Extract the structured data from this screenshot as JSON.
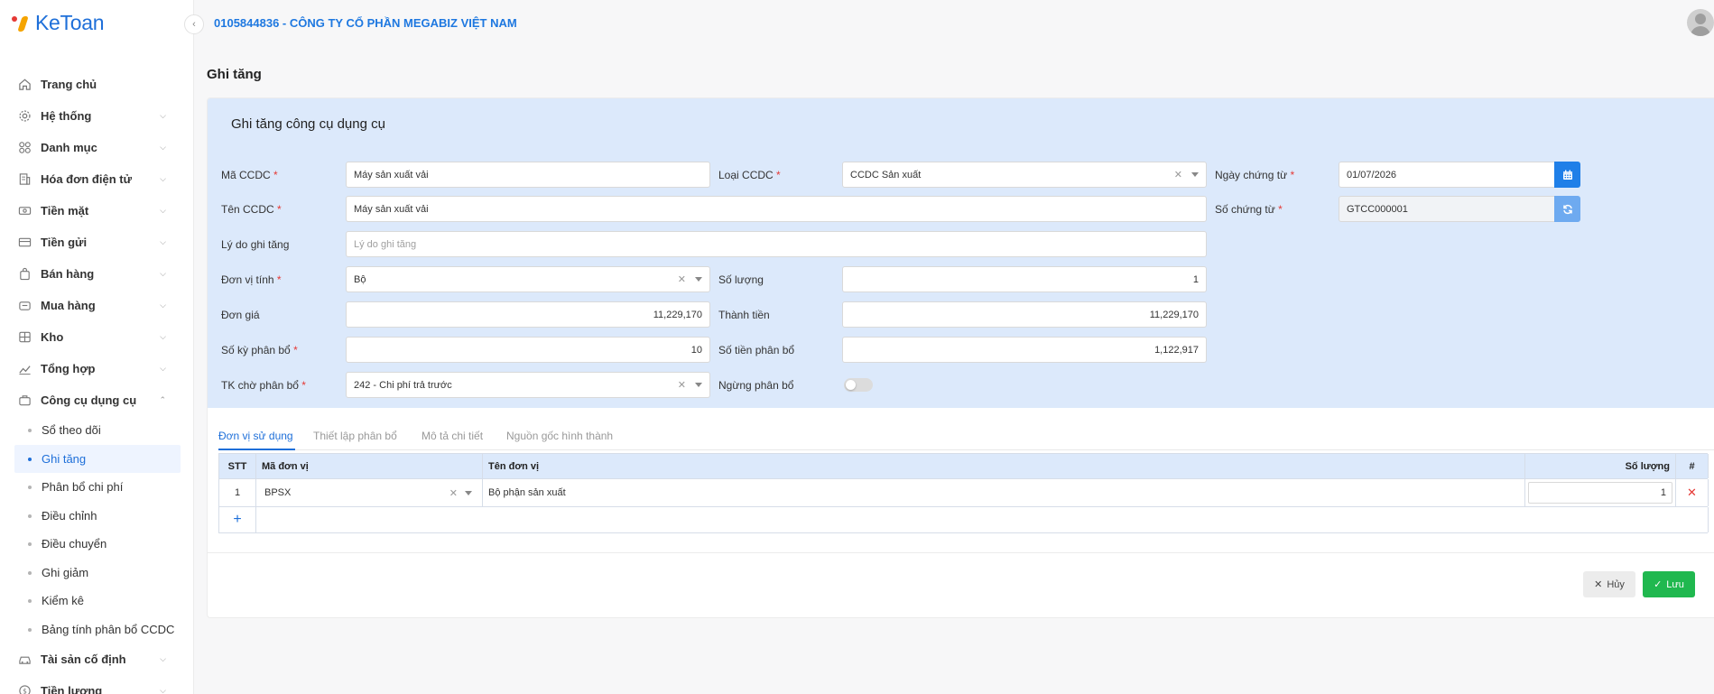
{
  "app": {
    "logo_text": "KeToan"
  },
  "header": {
    "company": "0105844836 - CÔNG TY CỔ PHẦN MEGABIZ VIỆT NAM"
  },
  "sidebar": {
    "items": [
      {
        "label": "Trang chủ",
        "icon": "home-icon"
      },
      {
        "label": "Hệ thống",
        "icon": "gear-icon"
      },
      {
        "label": "Danh mục",
        "icon": "grid-icon"
      },
      {
        "label": "Hóa đơn điện tử",
        "icon": "invoice-icon"
      },
      {
        "label": "Tiền mặt",
        "icon": "cash-icon"
      },
      {
        "label": "Tiền gửi",
        "icon": "card-icon"
      },
      {
        "label": "Bán hàng",
        "icon": "bag-icon"
      },
      {
        "label": "Mua hàng",
        "icon": "cart-icon"
      },
      {
        "label": "Kho",
        "icon": "warehouse-icon"
      },
      {
        "label": "Tổng hợp",
        "icon": "chart-icon"
      },
      {
        "label": "Công cụ dụng cụ",
        "icon": "tools-icon"
      },
      {
        "label": "Tài sản cố định",
        "icon": "car-icon"
      },
      {
        "label": "Tiền lương",
        "icon": "dollar-icon"
      }
    ],
    "sub_items": [
      "Sổ theo dõi",
      "Ghi tăng",
      "Phân bổ chi phí",
      "Điều chỉnh",
      "Điều chuyển",
      "Ghi giảm",
      "Kiểm kê",
      "Bảng tính phân bổ CCDC"
    ]
  },
  "page": {
    "title": "Ghi tăng"
  },
  "form": {
    "title": "Ghi tăng công cụ dụng cụ",
    "ma_ccdc": {
      "label": "Mã CCDC",
      "value": "Máy sản xuất vải"
    },
    "loai_ccdc": {
      "label": "Loại CCDC",
      "value": "CCDC Sản xuất"
    },
    "ngay_chung_tu": {
      "label": "Ngày chứng từ",
      "value": "01/07/2026"
    },
    "ten_ccdc": {
      "label": "Tên CCDC",
      "value": "Máy sản xuất vải"
    },
    "so_chung_tu": {
      "label": "Số chứng từ",
      "value": "GTCC000001"
    },
    "ly_do": {
      "label": "Lý do ghi tăng",
      "placeholder": "Lý do ghi tăng"
    },
    "don_vi_tinh": {
      "label": "Đơn vị tính",
      "value": "Bộ"
    },
    "so_luong": {
      "label": "Số lượng",
      "value": "1"
    },
    "don_gia": {
      "label": "Đơn giá",
      "value": "11,229,170"
    },
    "thanh_tien": {
      "label": "Thành tiền",
      "value": "11,229,170"
    },
    "so_ky": {
      "label": "Số kỳ phân bổ",
      "value": "10"
    },
    "so_tien_pb": {
      "label": "Số tiền phân bổ",
      "value": "1,122,917"
    },
    "tk_cho": {
      "label": "TK chờ phân bổ",
      "value": "242 - Chi phí trả trước"
    },
    "ngung_pb": {
      "label": "Ngừng phân bổ",
      "enabled": false
    },
    "required_mark": "*"
  },
  "tabs": [
    "Đơn vị sử dụng",
    "Thiết lập phân bổ",
    "Mô tả chi tiết",
    "Nguồn gốc hình thành"
  ],
  "table": {
    "headers": {
      "stt": "STT",
      "ma": "Mã đơn vị",
      "ten": "Tên đơn vị",
      "sl": "Số lượng",
      "action": "#"
    },
    "rows": [
      {
        "stt": "1",
        "ma": "BPSX",
        "ten": "Bộ phận sản xuất",
        "sl": "1"
      }
    ],
    "add_symbol": "+"
  },
  "actions": {
    "cancel": "Hủy",
    "save": "Lưu"
  },
  "colors": {
    "accent": "#1e6fd9",
    "form_bg": "#dce9fb",
    "save": "#20b84f",
    "required": "#e53935"
  }
}
